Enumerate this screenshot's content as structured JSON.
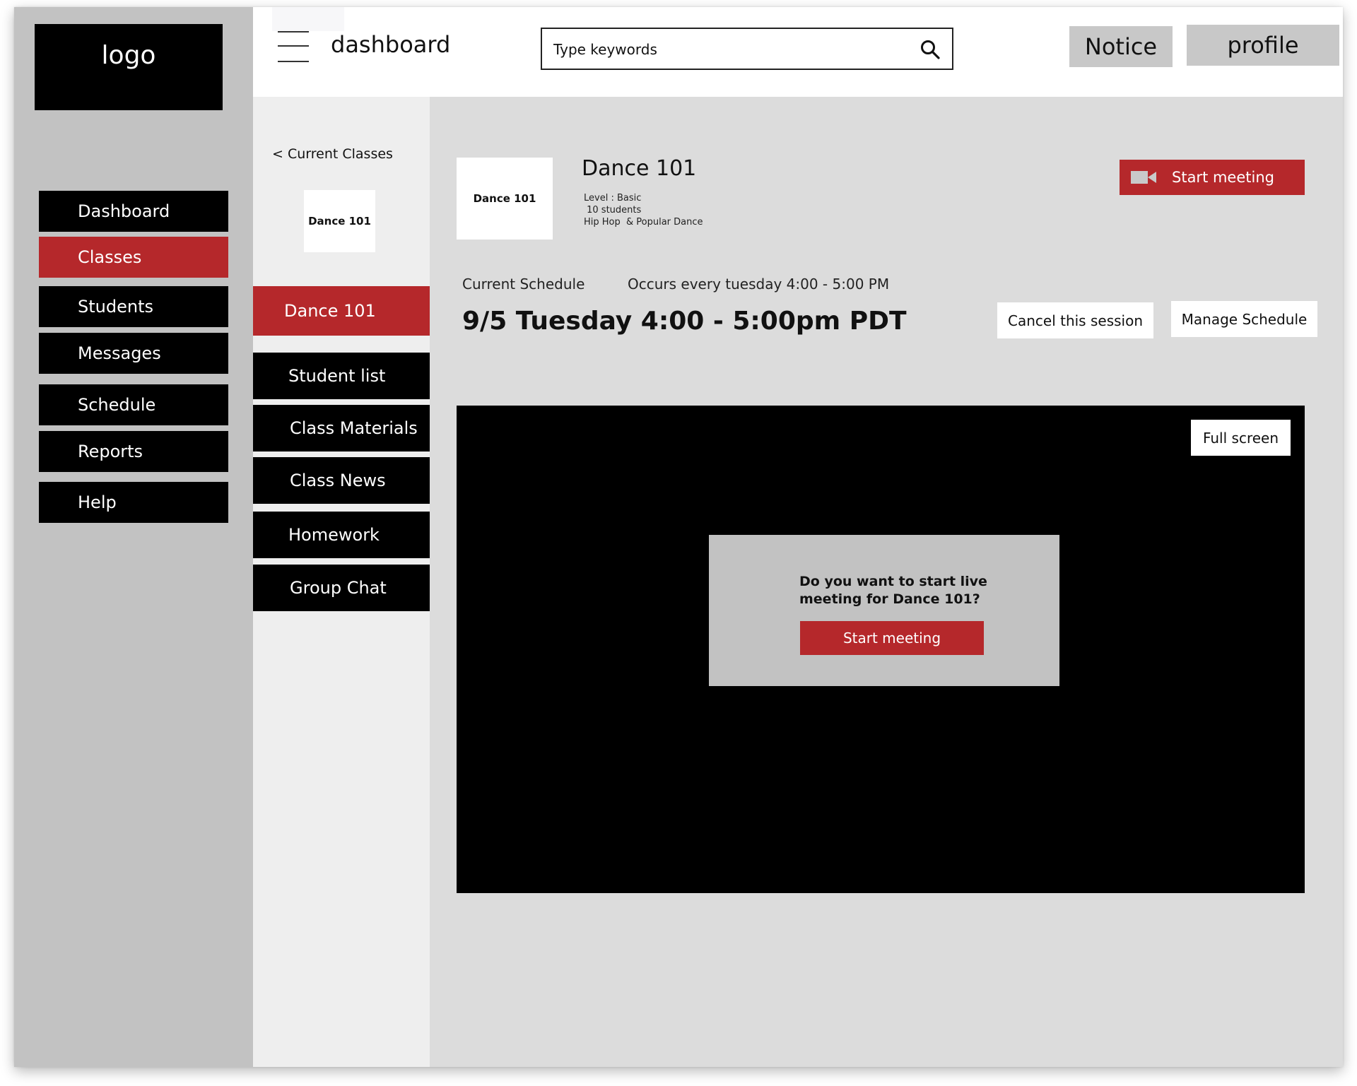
{
  "sidebar": {
    "logo": "logo",
    "items": [
      {
        "label": "Dashboard"
      },
      {
        "label": "Classes"
      },
      {
        "label": "Students"
      },
      {
        "label": "Messages"
      },
      {
        "label": "Schedule"
      },
      {
        "label": "Reports"
      },
      {
        "label": "Help"
      }
    ],
    "active_item": "Classes"
  },
  "header": {
    "title": "dashboard",
    "search_placeholder": "Type keywords",
    "notice_label": "Notice",
    "profile_label": "profile"
  },
  "class_menu": {
    "back_label": "< Current Classes",
    "thumb_label": "Dance 101",
    "items": [
      {
        "label": "Dance 101"
      },
      {
        "label": "Student list"
      },
      {
        "label": "Class Materials"
      },
      {
        "label": "Class News"
      },
      {
        "label": "Homework"
      },
      {
        "label": "Group Chat"
      }
    ],
    "active_item": "Dance 101"
  },
  "class_detail": {
    "thumb_label": "Dance 101",
    "title": "Dance 101",
    "level": "Level : Basic",
    "students": " 10 students",
    "genre": "Hip Hop  & Popular Dance",
    "start_meeting_label": "Start meeting"
  },
  "schedule": {
    "label": "Current Schedule",
    "occurrence": "Occurs every tuesday 4:00 - 5:00 PM",
    "session": "9/5 Tuesday 4:00 - 5:00pm PDT",
    "cancel_label": "Cancel this session",
    "manage_label": "Manage Schedule"
  },
  "video": {
    "fullscreen_label": "Full screen",
    "dialog_line1": "Do you want to start live",
    "dialog_line2": "meeting for Dance 101?",
    "dialog_button": "Start meeting"
  },
  "colors": {
    "accent": "#b5282b",
    "sidebar_bg": "#c2c2c2",
    "main_bg": "#dcdcdc",
    "submenu_bg": "#eeeeee"
  }
}
